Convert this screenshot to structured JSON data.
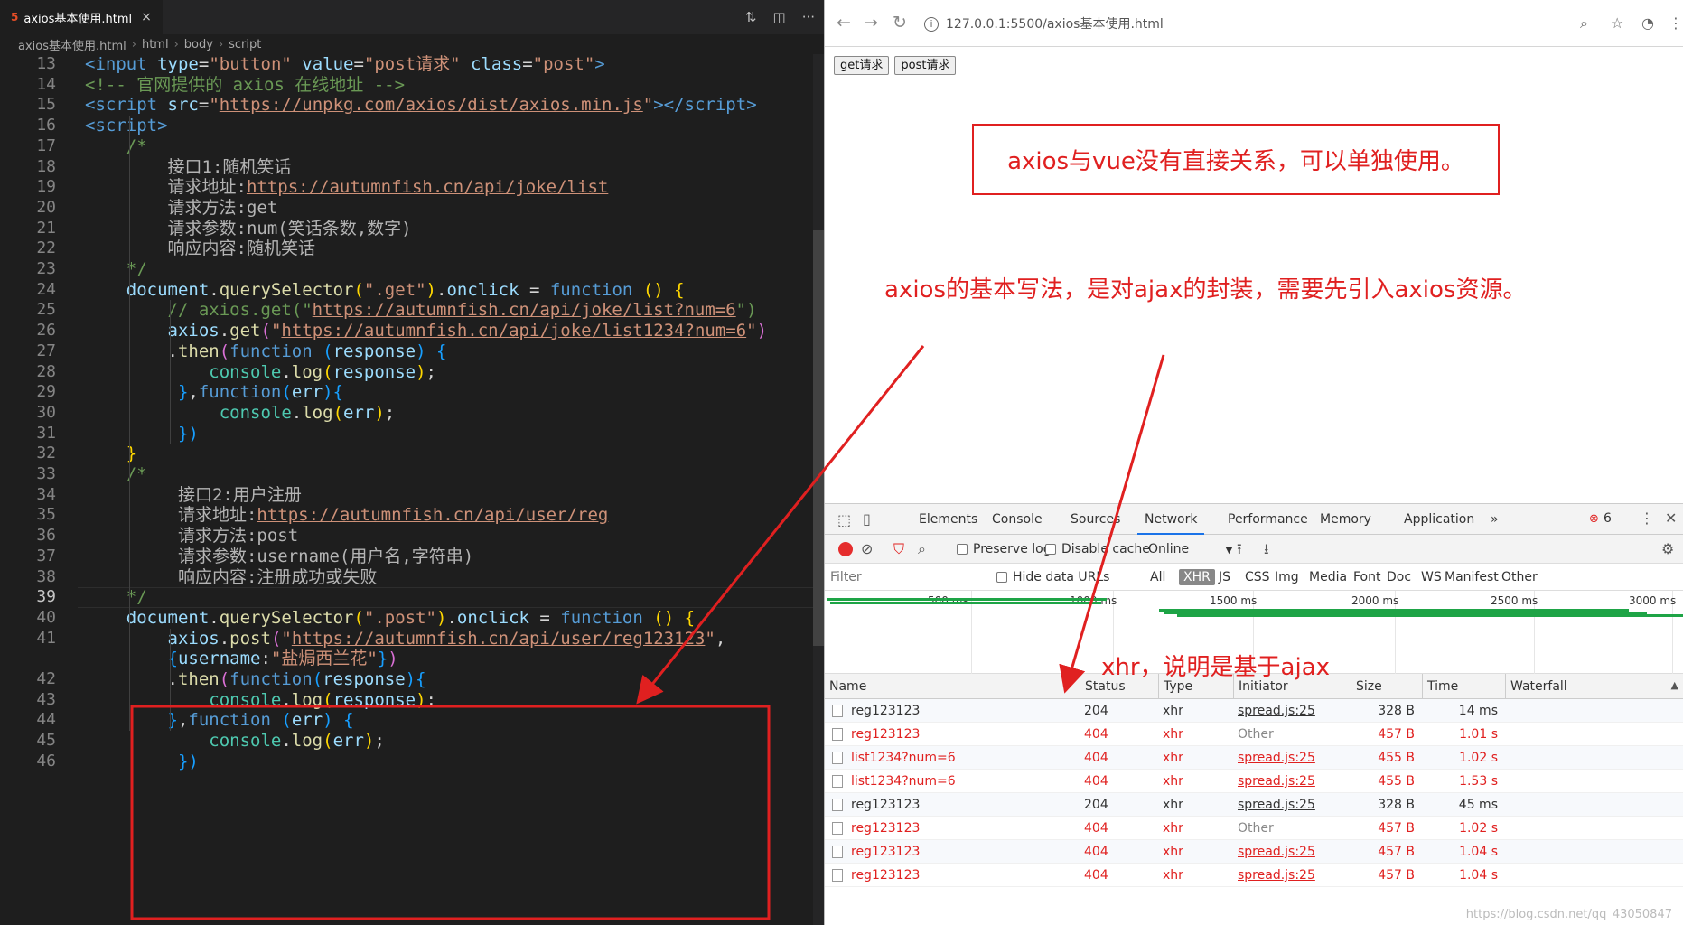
{
  "editor": {
    "tab_title": "axios基本使用.html",
    "tab_close": "×",
    "breadcrumb": [
      "axios基本使用.html",
      "html",
      "body",
      "script"
    ],
    "lines": [
      {
        "n": "13",
        "segs": [
          [
            "<",
            "tag"
          ],
          [
            "input ",
            "tag"
          ],
          [
            "type",
            "attr"
          ],
          [
            "=",
            "pn"
          ],
          [
            "\"button\"",
            "str"
          ],
          [
            " value",
            "attr"
          ],
          [
            "=",
            "pn"
          ],
          [
            "\"post请求\"",
            "str"
          ],
          [
            " class",
            "attr"
          ],
          [
            "=",
            "pn"
          ],
          [
            "\"post\"",
            "str"
          ],
          [
            ">",
            "tag"
          ]
        ]
      },
      {
        "n": "14",
        "segs": [
          [
            "<!-- 官网提供的 axios 在线地址 -->",
            "cmt"
          ]
        ]
      },
      {
        "n": "15",
        "segs": [
          [
            "<",
            "tag"
          ],
          [
            "script ",
            "tag"
          ],
          [
            "src",
            "attr"
          ],
          [
            "=",
            "pn"
          ],
          [
            "\"",
            "str"
          ],
          [
            "https://unpkg.com/axios/dist/axios.min.js",
            "url"
          ],
          [
            "\"",
            "str"
          ],
          [
            "></",
            "tag"
          ],
          [
            "script",
            "tag"
          ],
          [
            ">",
            "tag"
          ]
        ]
      },
      {
        "n": "16",
        "segs": [
          [
            "<",
            "tag"
          ],
          [
            "script",
            "tag"
          ],
          [
            ">",
            "tag"
          ]
        ]
      },
      {
        "n": "17",
        "segs": [
          [
            "    /*",
            "cmt"
          ]
        ]
      },
      {
        "n": "18",
        "segs": [
          [
            "        接口1:随机笑话",
            "ann"
          ]
        ]
      },
      {
        "n": "19",
        "segs": [
          [
            "        请求地址:",
            "ann"
          ],
          [
            "https://autumnfish.cn/api/joke/list",
            "url"
          ]
        ]
      },
      {
        "n": "20",
        "segs": [
          [
            "        请求方法:get",
            "ann"
          ]
        ]
      },
      {
        "n": "21",
        "segs": [
          [
            "        请求参数:num(笑话条数,数字)",
            "ann"
          ]
        ]
      },
      {
        "n": "22",
        "segs": [
          [
            "        响应内容:随机笑话",
            "ann"
          ]
        ]
      },
      {
        "n": "23",
        "segs": [
          [
            "    */",
            "cmt"
          ]
        ]
      },
      {
        "n": "24",
        "segs": [
          [
            "    document",
            "var"
          ],
          [
            ".",
            "pn"
          ],
          [
            "querySelector",
            "fn"
          ],
          [
            "(",
            "brk1"
          ],
          [
            "\".get\"",
            "str"
          ],
          [
            ")",
            "brk1"
          ],
          [
            ".",
            "pn"
          ],
          [
            "onclick",
            "var"
          ],
          [
            " = ",
            "pn"
          ],
          [
            "function",
            "kw"
          ],
          [
            " ",
            "pn"
          ],
          [
            "()",
            "brk1"
          ],
          [
            " ",
            "pn"
          ],
          [
            "{",
            "brk1"
          ]
        ]
      },
      {
        "n": "25",
        "segs": [
          [
            "        // axios.get(\"",
            "cmt"
          ],
          [
            "https://autumnfish.cn/api/joke/list?num=6",
            "url"
          ],
          [
            "\")",
            "cmt"
          ]
        ]
      },
      {
        "n": "26",
        "segs": [
          [
            "        axios",
            "var"
          ],
          [
            ".",
            "pn"
          ],
          [
            "get",
            "fn"
          ],
          [
            "(",
            "brk2"
          ],
          [
            "\"",
            "str"
          ],
          [
            "https://autumnfish.cn/api/joke/list1234?num=6",
            "url"
          ],
          [
            "\"",
            "str"
          ],
          [
            ")",
            "brk2"
          ]
        ]
      },
      {
        "n": "27",
        "segs": [
          [
            "        .",
            "pn"
          ],
          [
            "then",
            "fn"
          ],
          [
            "(",
            "brk2"
          ],
          [
            "function",
            "kw"
          ],
          [
            " ",
            "pn"
          ],
          [
            "(",
            "brk3"
          ],
          [
            "response",
            "var"
          ],
          [
            ")",
            "brk3"
          ],
          [
            " ",
            "pn"
          ],
          [
            "{",
            "brk3"
          ]
        ]
      },
      {
        "n": "28",
        "segs": [
          [
            "            console",
            "obj"
          ],
          [
            ".",
            "pn"
          ],
          [
            "log",
            "fn"
          ],
          [
            "(",
            "brk1"
          ],
          [
            "response",
            "var"
          ],
          [
            ")",
            "brk1"
          ],
          [
            ";",
            "pn"
          ]
        ]
      },
      {
        "n": "29",
        "segs": [
          [
            "         }",
            "brk3"
          ],
          [
            ",",
            "pn"
          ],
          [
            "function",
            "kw"
          ],
          [
            "(",
            "brk3"
          ],
          [
            "err",
            "var"
          ],
          [
            ")",
            "brk3"
          ],
          [
            "{",
            "brk3"
          ]
        ]
      },
      {
        "n": "30",
        "segs": [
          [
            "             console",
            "obj"
          ],
          [
            ".",
            "pn"
          ],
          [
            "log",
            "fn"
          ],
          [
            "(",
            "brk1"
          ],
          [
            "err",
            "var"
          ],
          [
            ")",
            "brk1"
          ],
          [
            ";",
            "pn"
          ]
        ]
      },
      {
        "n": "31",
        "segs": [
          [
            "         })",
            "brk3"
          ]
        ]
      },
      {
        "n": "32",
        "segs": [
          [
            "    }",
            "brk1"
          ]
        ]
      },
      {
        "n": "33",
        "segs": [
          [
            "    /*",
            "cmt"
          ]
        ]
      },
      {
        "n": "34",
        "segs": [
          [
            "         接口2:用户注册",
            "ann"
          ]
        ]
      },
      {
        "n": "35",
        "segs": [
          [
            "         请求地址:",
            "ann"
          ],
          [
            "https://autumnfish.cn/api/user/reg",
            "url"
          ]
        ]
      },
      {
        "n": "36",
        "segs": [
          [
            "         请求方法:post",
            "ann"
          ]
        ]
      },
      {
        "n": "37",
        "segs": [
          [
            "         请求参数:username(用户名,字符串)",
            "ann"
          ]
        ]
      },
      {
        "n": "38",
        "segs": [
          [
            "         响应内容:注册成功或失败",
            "ann"
          ]
        ]
      },
      {
        "n": "39",
        "segs": [
          [
            "    */",
            "cmt"
          ]
        ],
        "active": true
      },
      {
        "n": "40",
        "segs": [
          [
            "    document",
            "var"
          ],
          [
            ".",
            "pn"
          ],
          [
            "querySelector",
            "fn"
          ],
          [
            "(",
            "brk1"
          ],
          [
            "\".post\"",
            "str"
          ],
          [
            ")",
            "brk1"
          ],
          [
            ".",
            "pn"
          ],
          [
            "onclick",
            "var"
          ],
          [
            " = ",
            "pn"
          ],
          [
            "function",
            "kw"
          ],
          [
            " ",
            "pn"
          ],
          [
            "()",
            "brk1"
          ],
          [
            " ",
            "pn"
          ],
          [
            "{",
            "brk1"
          ]
        ]
      },
      {
        "n": "41",
        "segs": [
          [
            "        axios",
            "var"
          ],
          [
            ".",
            "pn"
          ],
          [
            "post",
            "fn"
          ],
          [
            "(",
            "brk2"
          ],
          [
            "\"",
            "str"
          ],
          [
            "https://autumnfish.cn/api/user/reg123123",
            "url"
          ],
          [
            "\"",
            "str"
          ],
          [
            ",",
            "pn"
          ]
        ]
      },
      {
        "n": "",
        "segs": [
          [
            "        {",
            "brk3"
          ],
          [
            "username",
            "var"
          ],
          [
            ":",
            "pn"
          ],
          [
            "\"盐焗西兰花\"",
            "str"
          ],
          [
            "}",
            "brk3"
          ],
          [
            ")",
            "brk2"
          ]
        ]
      },
      {
        "n": "42",
        "segs": [
          [
            "        .",
            "pn"
          ],
          [
            "then",
            "fn"
          ],
          [
            "(",
            "brk2"
          ],
          [
            "function",
            "kw"
          ],
          [
            "(",
            "brk3"
          ],
          [
            "response",
            "var"
          ],
          [
            ")",
            "brk3"
          ],
          [
            "{",
            "brk3"
          ]
        ]
      },
      {
        "n": "43",
        "segs": [
          [
            "            console",
            "obj"
          ],
          [
            ".",
            "pn"
          ],
          [
            "log",
            "fn"
          ],
          [
            "(",
            "brk1"
          ],
          [
            "response",
            "var"
          ],
          [
            ")",
            "brk1"
          ],
          [
            ";",
            "pn"
          ]
        ]
      },
      {
        "n": "44",
        "segs": [
          [
            "        }",
            "brk3"
          ],
          [
            ",",
            "pn"
          ],
          [
            "function",
            "kw"
          ],
          [
            " ",
            "pn"
          ],
          [
            "(",
            "brk3"
          ],
          [
            "err",
            "var"
          ],
          [
            ")",
            "brk3"
          ],
          [
            " ",
            "pn"
          ],
          [
            "{",
            "brk3"
          ]
        ]
      },
      {
        "n": "45",
        "segs": [
          [
            "            console",
            "obj"
          ],
          [
            ".",
            "pn"
          ],
          [
            "log",
            "fn"
          ],
          [
            "(",
            "brk1"
          ],
          [
            "err",
            "var"
          ],
          [
            ")",
            "brk1"
          ],
          [
            ";",
            "pn"
          ]
        ]
      },
      {
        "n": "46",
        "segs": [
          [
            "         })",
            "brk3"
          ]
        ]
      }
    ]
  },
  "browser": {
    "url": "127.0.0.1:5500/axios基本使用.html",
    "buttons": {
      "get": "get请求",
      "post": "post请求"
    }
  },
  "annotations": {
    "box_note": "axios与vue没有直接关系，可以单独使用。",
    "note_2": "axios的基本写法，是对ajax的封装，需要先引入axios资源。",
    "note_3": "xhr，说明是基于ajax"
  },
  "devtools": {
    "tabs": [
      "Elements",
      "Console",
      "Sources",
      "Network",
      "Performance",
      "Memory",
      "Application",
      "»"
    ],
    "active_tab": "Network",
    "error_count": "6",
    "toolbar": {
      "preserve_log": "Preserve log",
      "disable_cache": "Disable cache",
      "throttle": "Online"
    },
    "filter": {
      "placeholder": "Filter",
      "hide_data_urls": "Hide data URLs",
      "types": [
        "All",
        "XHR",
        "JS",
        "CSS",
        "Img",
        "Media",
        "Font",
        "Doc",
        "WS",
        "Manifest",
        "Other"
      ]
    },
    "timeline_ticks": [
      "500 ms",
      "1000 ms",
      "1500 ms",
      "2000 ms",
      "2500 ms",
      "3000 ms"
    ],
    "columns": [
      "Name",
      "Status",
      "Type",
      "Initiator",
      "Size",
      "Time",
      "Waterfall"
    ],
    "rows": [
      {
        "name": "reg123123",
        "status": "204",
        "type": "xhr",
        "initiator": "spread.js:25",
        "size": "328 B",
        "time": "14 ms",
        "error": false
      },
      {
        "name": "reg123123",
        "status": "404",
        "type": "xhr",
        "initiator": "Other",
        "size": "457 B",
        "time": "1.01 s",
        "error": true
      },
      {
        "name": "list1234?num=6",
        "status": "404",
        "type": "xhr",
        "initiator": "spread.js:25",
        "size": "455 B",
        "time": "1.02 s",
        "error": true
      },
      {
        "name": "list1234?num=6",
        "status": "404",
        "type": "xhr",
        "initiator": "spread.js:25",
        "size": "455 B",
        "time": "1.53 s",
        "error": true
      },
      {
        "name": "reg123123",
        "status": "204",
        "type": "xhr",
        "initiator": "spread.js:25",
        "size": "328 B",
        "time": "45 ms",
        "error": false
      },
      {
        "name": "reg123123",
        "status": "404",
        "type": "xhr",
        "initiator": "Other",
        "size": "457 B",
        "time": "1.02 s",
        "error": true
      },
      {
        "name": "reg123123",
        "status": "404",
        "type": "xhr",
        "initiator": "spread.js:25",
        "size": "457 B",
        "time": "1.04 s",
        "error": true
      },
      {
        "name": "reg123123",
        "status": "404",
        "type": "xhr",
        "initiator": "spread.js:25",
        "size": "457 B",
        "time": "1.04 s",
        "error": true
      }
    ]
  },
  "watermark": "https://blog.csdn.net/qq_43050847"
}
